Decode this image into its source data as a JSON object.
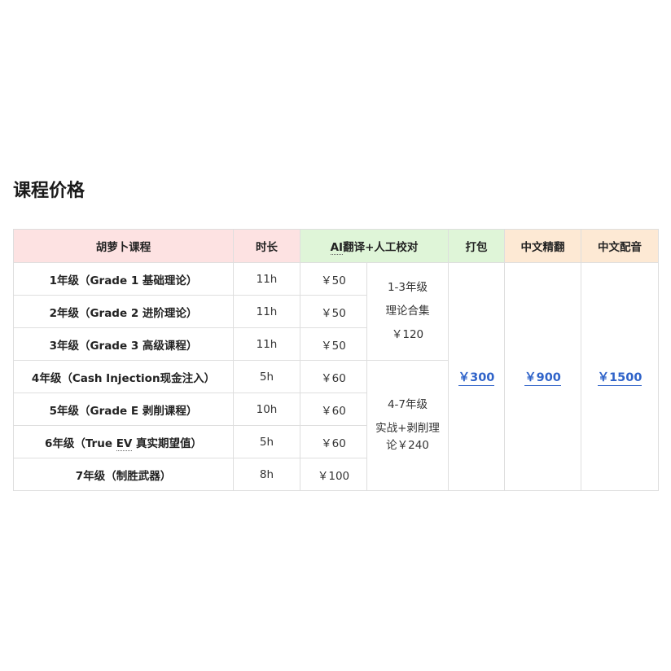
{
  "section_title": "课程价格",
  "headers": {
    "course": "胡萝卜课程",
    "duration": "时长",
    "ai_abbr": "AI",
    "ai_rest": "翻译+人工校对",
    "bundle": "打包",
    "cn_fine": "中文精翻",
    "cn_dub": "中文配音"
  },
  "rows": [
    {
      "course": "1年级（Grade 1 基础理论）",
      "duration": "11h",
      "ai_price": "￥50"
    },
    {
      "course": "2年级（Grade 2 进阶理论）",
      "duration": "11h",
      "ai_price": "￥50"
    },
    {
      "course": "3年级（Grade 3 高级课程）",
      "duration": "11h",
      "ai_price": "￥50"
    },
    {
      "course": "4年级（Cash Injection现金注入）",
      "duration": "5h",
      "ai_price": "￥60"
    },
    {
      "course": "5年级（Grade E 剥削课程）",
      "duration": "10h",
      "ai_price": "￥60"
    },
    {
      "course_pre": "6年级（True ",
      "course_abbr": "EV",
      "course_post": " 真实期望值）",
      "duration": "5h",
      "ai_price": "￥60"
    },
    {
      "course": "7年级（制胜武器）",
      "duration": "8h",
      "ai_price": "￥100"
    }
  ],
  "groups": {
    "g1_l1": "1-3年级",
    "g1_l2": "理论合集",
    "g1_l3": "￥120",
    "g2_l1": "4-7年级",
    "g2_l2": "实战+剥削理",
    "g2_l3": "论￥240"
  },
  "prices": {
    "bundle": "￥300",
    "cn_fine": "￥900",
    "cn_dub": "￥1500"
  },
  "colors": {
    "header_pink": "#fde2e2",
    "header_green": "#dff5d8",
    "header_orange": "#fde9d4",
    "link": "#2f63c9"
  }
}
